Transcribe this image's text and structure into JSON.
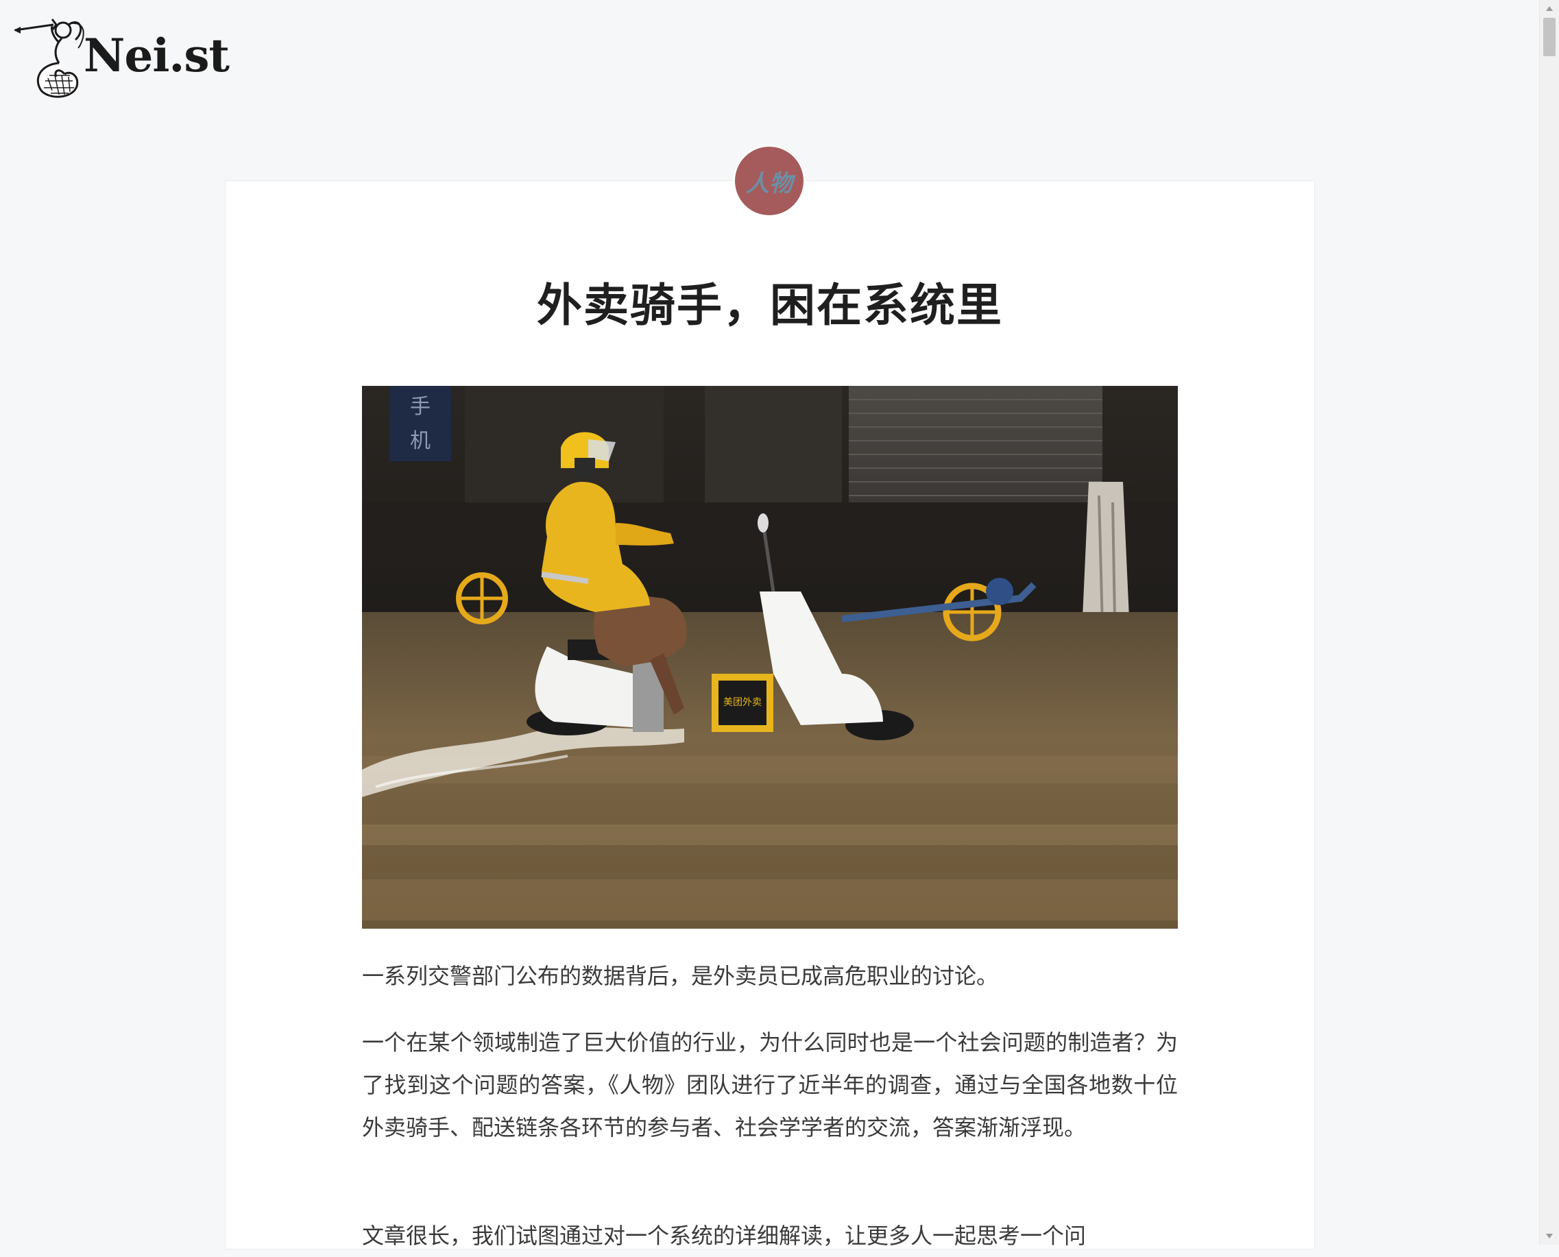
{
  "site": {
    "logo_text": "Nei.st"
  },
  "article": {
    "category_badge": "人物",
    "title": "外卖骑手，困在系统里",
    "paragraphs": [
      "一系列交警部门公布的数据背后，是外卖员已成高危职业的讨论。",
      "一个在某个领域制造了巨大价值的行业，为什么同时也是一个社会问题的制造者？为了找到这个问题的答案，《人物》团队进行了近半年的调查，通过与全国各地数十位外卖骑手、配送链条各环节的参与者、社会学学者的交流，答案渐渐浮现。",
      "文章很长，我们试图通过对一个系统的详细解读，让更多人一起思考一个问"
    ],
    "photo_signs": {
      "shop_sign": "手机",
      "delivery_box": "美团外卖"
    }
  },
  "colors": {
    "badge_bg": "#a55b5b",
    "badge_text": "#6d8fa6",
    "page_bg": "#f6f7f9",
    "raincoat": "#e8b51f"
  }
}
